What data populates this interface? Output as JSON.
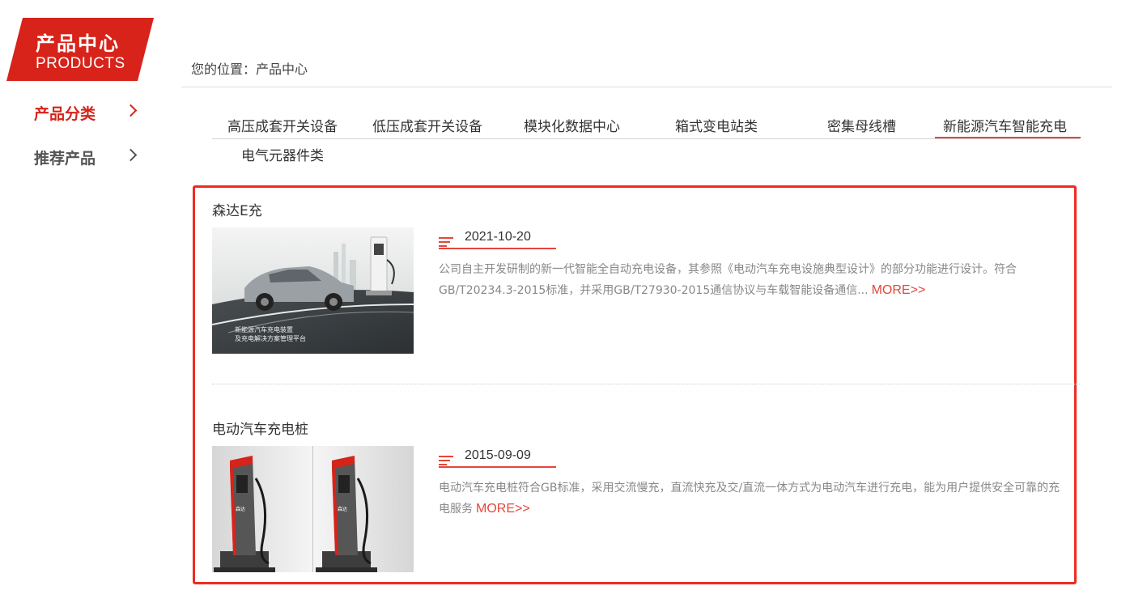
{
  "sidebar": {
    "banner_zh": "产品中心",
    "banner_en": "PRODUCTS",
    "items": [
      {
        "label": "产品分类",
        "active": true
      },
      {
        "label": "推荐产品",
        "active": false
      }
    ]
  },
  "breadcrumb": "您的位置：产品中心",
  "tabs": [
    "高压成套开关设备",
    "低压成套开关设备",
    "模块化数据中心",
    "箱式变电站类",
    "密集母线槽",
    "新能源汽车智能充电",
    "电气元器件类"
  ],
  "active_tab": "新能源汽车智能充电",
  "products": [
    {
      "title": "森达E充",
      "date": "2021-10-20",
      "description": "公司自主开发研制的新一代智能全自动充电设备，其参照《电动汽车充电设施典型设计》的部分功能进行设计。符合GB/T20234.3-2015标准，并采用GB/T27930-2015通信协议与车载智能设备通信...",
      "more": "MORE>>",
      "image_caption_1": "新能源汽车充电装置",
      "image_caption_2": "及充电解决方案管理平台"
    },
    {
      "title": "电动汽车充电桩",
      "date": "2015-09-09",
      "description": "电动汽车充电桩符合GB标准，采用交流慢充，直流快充及交/直流一体方式为电动汽车进行充电，能为用户提供安全可靠的充电服务",
      "more": "MORE>>",
      "image_brand": "森达"
    }
  ],
  "colors": {
    "brand_red": "#d7231a",
    "accent_red": "#e4463a",
    "highlight_border": "#ee2b21"
  }
}
